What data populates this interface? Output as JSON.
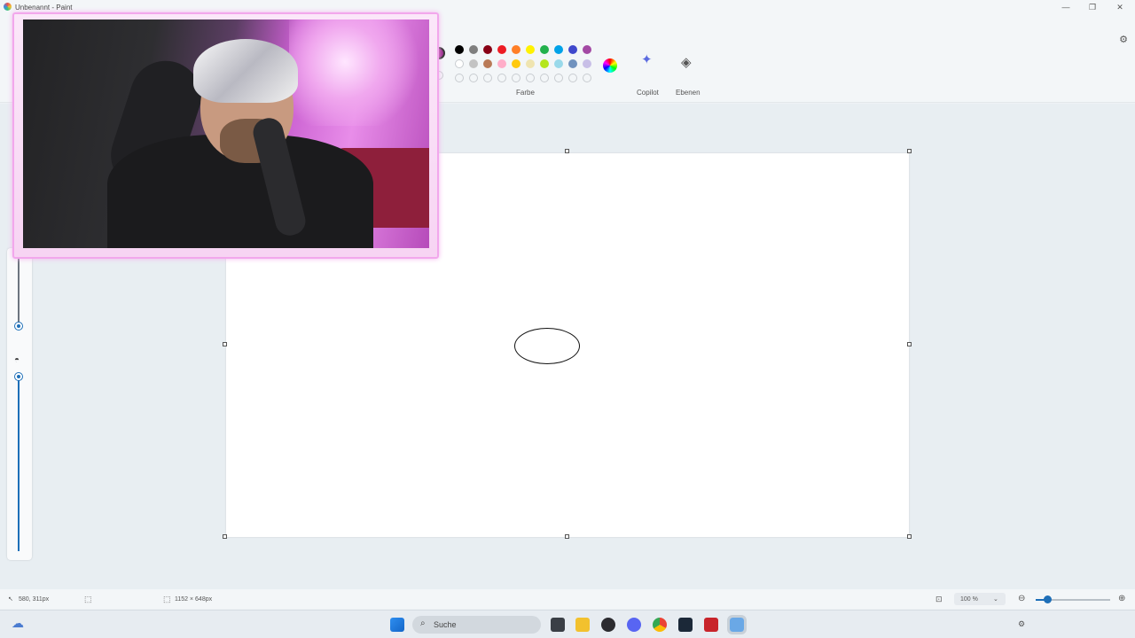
{
  "window": {
    "title": "Unbenannt - Paint"
  },
  "ribbon": {
    "colors_label": "Farbe",
    "copilot_label": "Copilot",
    "layers_label": "Ebenen",
    "current_color": "#9b2d8d",
    "palette_row1": [
      "#000000",
      "#7f7f7f",
      "#880015",
      "#ed1c24",
      "#ff7f27",
      "#fff200",
      "#22b14c",
      "#00a2e8",
      "#3f48cc",
      "#a349a4"
    ],
    "palette_row2": [
      "#ffffff",
      "#c3c3c3",
      "#b97a57",
      "#ffaec9",
      "#ffc90e",
      "#efe4b0",
      "#b5e61d",
      "#99d9ea",
      "#7092be",
      "#c8bfe7"
    ]
  },
  "status": {
    "cursor_pos": "580, 311px",
    "canvas_size": "1152 × 648px",
    "zoom": "100 %"
  },
  "taskbar": {
    "search_placeholder": "Suche"
  },
  "icons": {
    "app": "paint-icon",
    "copilot": "copilot-icon",
    "layers": "layers-icon",
    "settings": "gear-icon"
  }
}
